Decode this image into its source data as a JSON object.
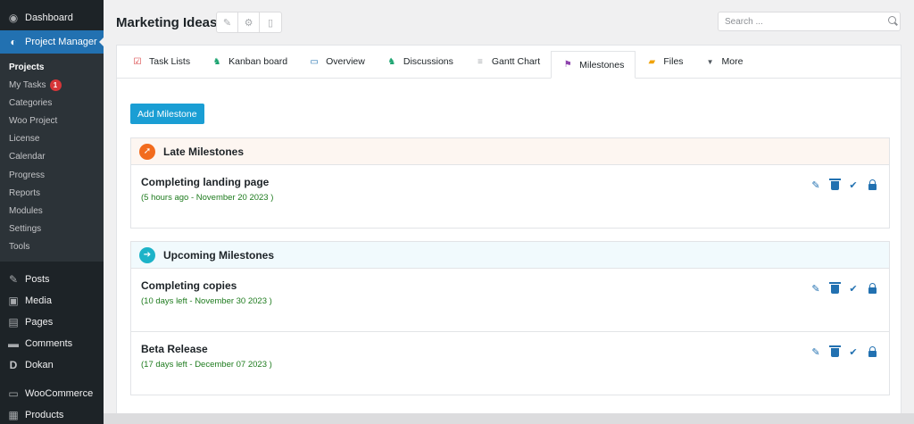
{
  "sidebar": {
    "dashboard": "Dashboard",
    "project_manager": "Project Manager",
    "sub_items": [
      {
        "label": "Projects",
        "current": true
      },
      {
        "label": "My Tasks",
        "badge": "1"
      },
      {
        "label": "Categories"
      },
      {
        "label": "Woo Project"
      },
      {
        "label": "License"
      },
      {
        "label": "Calendar"
      },
      {
        "label": "Progress"
      },
      {
        "label": "Reports"
      },
      {
        "label": "Modules"
      },
      {
        "label": "Settings"
      },
      {
        "label": "Tools"
      }
    ],
    "posts": "Posts",
    "media": "Media",
    "pages": "Pages",
    "comments": "Comments",
    "dokan": "Dokan",
    "woocommerce": "WooCommerce",
    "products": "Products"
  },
  "header": {
    "title": "Marketing Ideas",
    "search_placeholder": "Search ..."
  },
  "tabs": {
    "task_lists": "Task Lists",
    "kanban": "Kanban board",
    "overview": "Overview",
    "discussions": "Discussions",
    "gantt": "Gantt Chart",
    "milestones": "Milestones",
    "files": "Files",
    "more": "More"
  },
  "add_button": "Add Milestone",
  "late": {
    "title": "Late Milestones",
    "items": [
      {
        "title": "Completing landing page",
        "date": "(5 hours ago - November 20 2023 )"
      }
    ]
  },
  "upcoming": {
    "title": "Upcoming Milestones",
    "items": [
      {
        "title": "Completing copies",
        "date": "(10 days left - November 30 2023 )"
      },
      {
        "title": "Beta Release",
        "date": "(17 days left - December 07 2023 )"
      }
    ]
  },
  "colors": {
    "sidebar_bg": "#1d2327",
    "accent": "#2271b1",
    "button": "#1a9ed4",
    "late_icon": "#f26b1d",
    "upcoming_icon": "#1cb3c8",
    "date_text": "#1e7b1e"
  }
}
